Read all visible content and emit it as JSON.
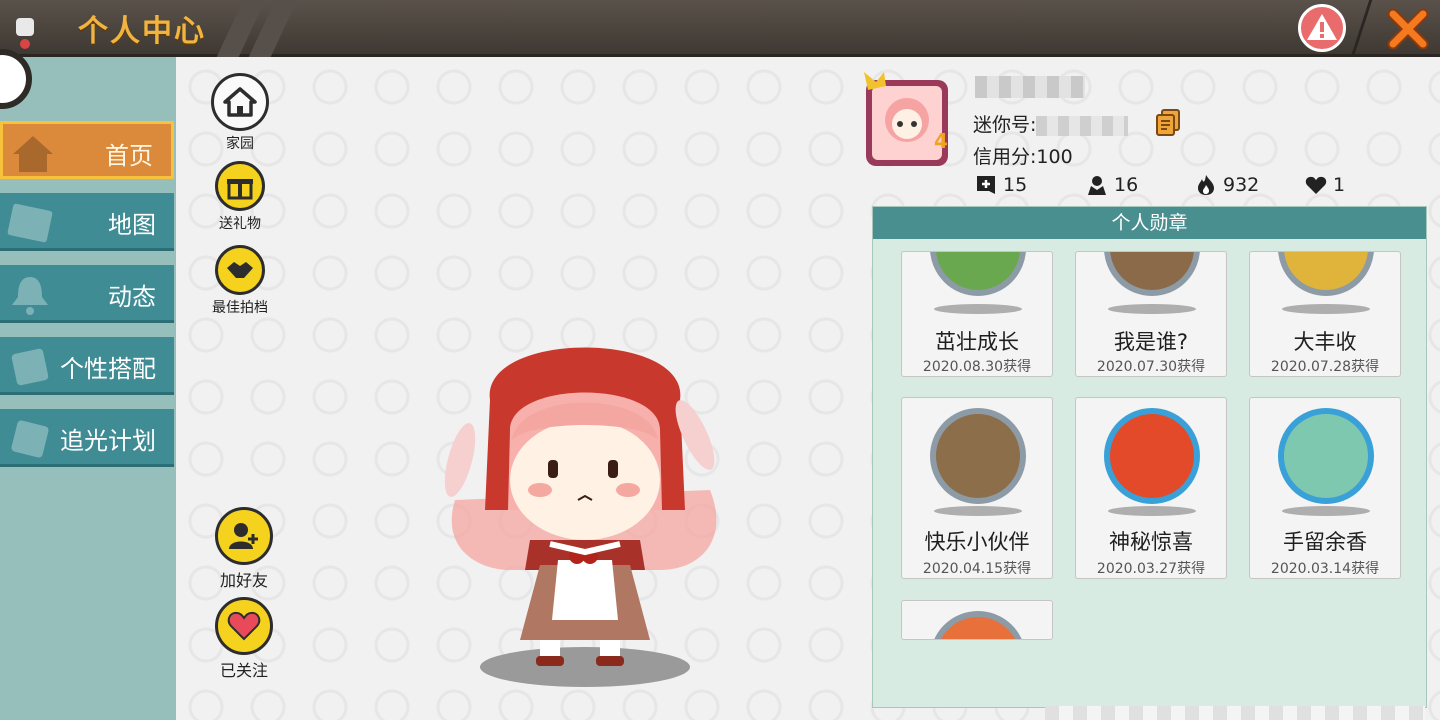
{
  "window": {
    "title": "个人中心",
    "accent": "#f2b43f"
  },
  "sidebar": {
    "items": [
      {
        "label": "首页",
        "icon": "house-icon",
        "active": true
      },
      {
        "label": "地图",
        "icon": "map-icon",
        "active": false
      },
      {
        "label": "动态",
        "icon": "bell-icon",
        "active": false
      },
      {
        "label": "个性搭配",
        "icon": "outfit-icon",
        "active": false
      },
      {
        "label": "追光计划",
        "icon": "plan-icon",
        "active": false
      }
    ]
  },
  "actions": {
    "home": "家园",
    "gift": "送礼物",
    "best_shot": "最佳拍档",
    "add_friend": "加好友",
    "following": "已关注"
  },
  "profile": {
    "mini_id_label": "迷你号:",
    "credit": "信用分:100",
    "stats": [
      {
        "icon": "plus-badge-icon",
        "value": "15"
      },
      {
        "icon": "fans-icon",
        "value": "16"
      },
      {
        "icon": "fire-icon",
        "value": "932"
      },
      {
        "icon": "heart-icon",
        "value": "1"
      }
    ]
  },
  "medals": {
    "title": "个人勋章",
    "items": [
      {
        "name": "茁壮成长",
        "date": "2020.08.30获得",
        "color": "#6aa84f"
      },
      {
        "name": "我是谁?",
        "date": "2020.07.30获得",
        "color": "#8b6a4a"
      },
      {
        "name": "大丰收",
        "date": "2020.07.28获得",
        "color": "#e0b43a"
      },
      {
        "name": "快乐小伙伴",
        "date": "2020.04.15获得",
        "color": "#8d6e4a"
      },
      {
        "name": "神秘惊喜",
        "date": "2020.03.27获得",
        "color": "#e34a2a"
      },
      {
        "name": "手留余香",
        "date": "2020.03.14获得",
        "color": "#7ec8b0"
      },
      {
        "name": "",
        "date": "",
        "color": "#e8703a"
      }
    ]
  }
}
